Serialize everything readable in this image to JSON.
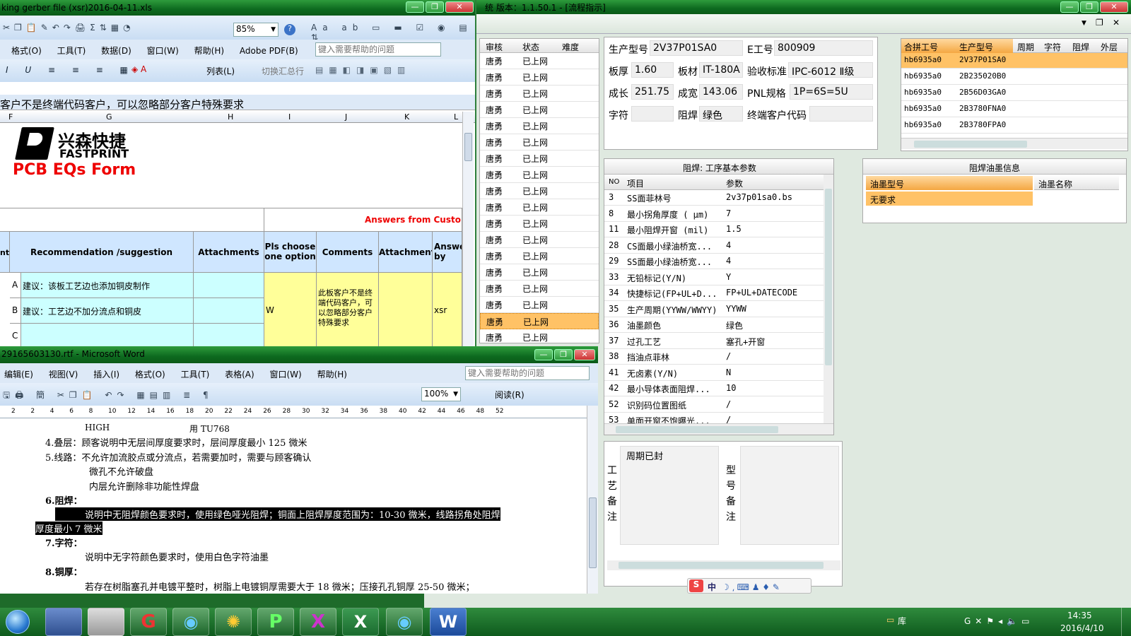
{
  "colors": {
    "desktop": "#1e6b2a",
    "excel_header": "#cfe6ff",
    "cyan_cell": "#ccffff",
    "yellow_cell": "#ffff99",
    "orange_header": "#f4a742",
    "highlight_row": "#ffc266"
  },
  "right_app": {
    "title": "统  版本：1.1.50.1 - [流程指示]",
    "info": {
      "prod_label": "生产型号",
      "prod_value": "2V37P01SA0",
      "e_label": "E工号",
      "e_value": "800909",
      "thick_label": "板厚",
      "thick_value": "1.60",
      "material_label": "板材",
      "material_value": "IT-180A",
      "std_label": "验收标准",
      "std_value": "IPC-6012 Ⅱ级",
      "len_label": "成长",
      "len_value": "251.75",
      "wid_label": "成宽",
      "wid_value": "143.06",
      "pnl_label": "PNL规格",
      "pnl_value": "1P=6S=5U",
      "char_label": "字符",
      "char_value": "",
      "mask_label": "阻焊",
      "mask_value": "绿色",
      "cust_label": "终端客户代码",
      "cust_value": ""
    },
    "merge_table": {
      "headers": [
        "合拼工号",
        "生产型号",
        "周期",
        "字符",
        "阻焊",
        "外层"
      ],
      "rows": [
        [
          "hb6935a0",
          "2V37P01SA0"
        ],
        [
          "hb6935a0",
          "2B235020B0"
        ],
        [
          "hb6935a0",
          "2B56D03GA0"
        ],
        [
          "hb6935a0",
          "2B3780FNA0"
        ],
        [
          "hb6935a0",
          "2B3780FPA0"
        ]
      ]
    },
    "params": {
      "title": "阻焊: 工序基本参数",
      "headers": [
        "NO",
        "项目",
        "参数"
      ],
      "rows": [
        [
          "3",
          "SS面菲林号",
          "2v37p01sa0.bs"
        ],
        [
          "8",
          "最小拐角厚度 ( μm)",
          "7"
        ],
        [
          "11",
          "最小阻焊开窗 (mil)",
          "1.5"
        ],
        [
          "28",
          "CS面最小绿油桥宽...",
          "4"
        ],
        [
          "29",
          "SS面最小绿油桥宽...",
          "4"
        ],
        [
          "33",
          "无铅标记(Y/N)",
          "Y"
        ],
        [
          "34",
          "快捷标记(FP+UL+D...",
          "FP+UL+DATECODE"
        ],
        [
          "35",
          "生产周期(YYWW/WWYY)",
          "YYWW"
        ],
        [
          "36",
          "油墨颜色",
          "绿色"
        ],
        [
          "37",
          "过孔工艺",
          "塞孔+开窗"
        ],
        [
          "38",
          "挡油点菲林",
          "/"
        ],
        [
          "41",
          "无卤素(Y/N)",
          "N"
        ],
        [
          "42",
          "最小导体表面阻焊...",
          "10"
        ],
        [
          "52",
          "识别码位置图纸",
          "/"
        ],
        [
          "53",
          "单面开窗不饱曝光...",
          "/"
        ]
      ]
    },
    "ink": {
      "title": "阻焊油墨信息",
      "headers": [
        "油墨型号",
        "油墨名称"
      ],
      "rows": [
        [
          "无要求",
          ""
        ]
      ]
    },
    "notes": {
      "craft_label": "工艺备注",
      "craft_text": "周期已封",
      "model_label": "型号备注"
    },
    "ime": "中"
  },
  "middle_list": {
    "headers": [
      "审核",
      "状态",
      "难度"
    ],
    "rows": [
      [
        "唐勇",
        "已上网"
      ],
      [
        "唐勇",
        "已上网"
      ],
      [
        "唐勇",
        "已上网"
      ],
      [
        "唐勇",
        "已上网"
      ],
      [
        "唐勇",
        "已上网"
      ],
      [
        "唐勇",
        "已上网"
      ],
      [
        "唐勇",
        "已上网"
      ],
      [
        "唐勇",
        "已上网"
      ],
      [
        "唐勇",
        "已上网"
      ],
      [
        "唐勇",
        "已上网"
      ],
      [
        "唐勇",
        "已上网"
      ],
      [
        "唐勇",
        "已上网"
      ],
      [
        "唐勇",
        "已上网"
      ],
      [
        "唐勇",
        "已上网"
      ],
      [
        "唐勇",
        "已上网"
      ],
      [
        "唐勇",
        "已上网"
      ],
      [
        "唐勇",
        "已上网"
      ],
      [
        "唐勇",
        "已上网"
      ]
    ]
  },
  "excel": {
    "title": "king gerber file (xsr)2016-04-11.xls",
    "menu": [
      "格式(O)",
      "工具(T)",
      "数据(D)",
      "窗口(W)",
      "帮助(H)",
      "Adobe PDF(B)"
    ],
    "help_placeholder": "键入需要帮助的问题",
    "zoom": "85%",
    "listbtn": "列表(L)",
    "sumtb": "切换汇总行",
    "formula": "客户不是终端代码客户，可以忽略部分客户特殊要求",
    "cols": [
      "F",
      "G",
      "H",
      "I",
      "J",
      "K",
      "L"
    ],
    "logo_cn": "兴森快捷",
    "logo_en": "FASTPRINT",
    "form_title": "PCB EQs Form",
    "answers_header": "Answers from Custo",
    "h_rec": "Recommendation /suggestion",
    "h_att": "Attachments",
    "h_choose": "Pls choose one option",
    "h_comments": "Comments",
    "h_attachment": "Attachment",
    "h_answer": "Answe by",
    "h_nt": "nt",
    "row_a": "建议：该板工艺边也添加铜皮制作",
    "row_b": "建议：工艺边不加分流点和铜皮",
    "lab_a": "A",
    "lab_b": "B",
    "lab_c": "C",
    "choose_val": "W",
    "comment": "此板客户不是终端代码客户，可以忽略部分客户特殊要求",
    "answer_by": "xsr"
  },
  "word": {
    "title": "29165603130.rtf - Microsoft Word",
    "menu": [
      "编辑(E)",
      "视图(V)",
      "插入(I)",
      "格式(O)",
      "工具(T)",
      "表格(A)",
      "窗口(W)",
      "帮助(H)"
    ],
    "help_placeholder": "键入需要帮助的问题",
    "zoom": "100%",
    "read_btn": "阅读(R)",
    "ruler": [
      "2",
      "2",
      "4",
      "6",
      "8",
      "10",
      "12",
      "14",
      "16",
      "18",
      "20",
      "22",
      "24",
      "26",
      "28",
      "30",
      "32",
      "34",
      "36",
      "38",
      "40",
      "42",
      "44",
      "46",
      "48",
      "52"
    ],
    "lines": {
      "l0a": "HIGH",
      "l0b": "用 TU768",
      "l1": "4.叠层：顾客说明中无层间厚度要求时，层间厚度最小 125 微米",
      "l2": "5.线路：不允许加流胶点或分流点，若需要加时，需要与顾客确认",
      "l3": "微孔不允许破盘",
      "l4": "内层允许删除非功能性焊盘",
      "l5": "6.阻焊：",
      "l6": "说明中无阻焊颜色要求时，使用绿色哑光阻焊；铜面上阻焊厚度范围为：10-30 微米，线路拐角处阻焊",
      "l7": "厚度最小 7 微米",
      "l8": "7.字符：",
      "l9": "说明中无字符颜色要求时，使用白色字符油墨",
      "l10": "8.铜厚：",
      "l11": "若存在树脂塞孔并电镀平整时，树脂上电镀铜厚需要大于 18 微米；压接孔孔铜厚 25-50 微米；"
    }
  },
  "taskbar": {
    "library": "库",
    "time": "14:35",
    "date": "2016/4/10"
  }
}
